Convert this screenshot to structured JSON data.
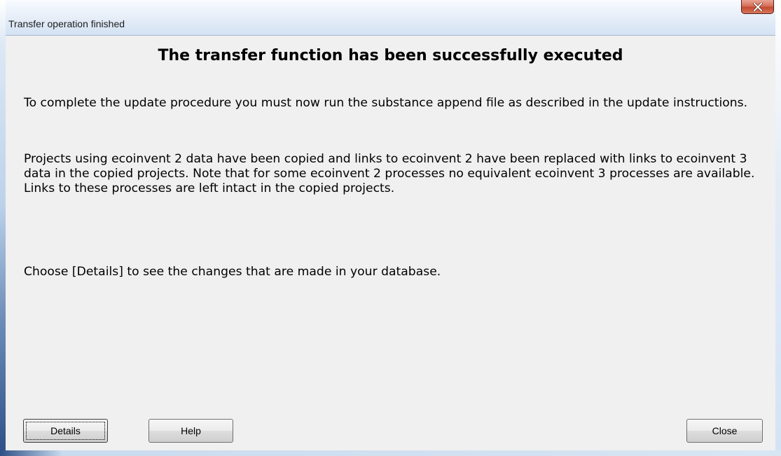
{
  "window": {
    "title": "Transfer operation finished"
  },
  "dialog": {
    "heading": "The transfer function has been successfully executed",
    "paragraphs": [
      "To complete the update procedure you must now run the substance append file as described in the update instructions.",
      "Projects using ecoinvent 2 data have been copied and links to ecoinvent 2 have been replaced with links to ecoinvent 3 data in the copied projects. Note that for some ecoinvent 2 processes no equivalent ecoinvent 3 processes are available. Links to these processes are left intact in the copied projects.",
      "Choose [Details] to see the changes that are made in your database."
    ]
  },
  "buttons": {
    "details": "Details",
    "help": "Help",
    "close": "Close"
  },
  "icons": {
    "window_close": "close-icon"
  },
  "colors": {
    "close_button": "#c44a30",
    "dialog_background": "#f0f0f0"
  }
}
